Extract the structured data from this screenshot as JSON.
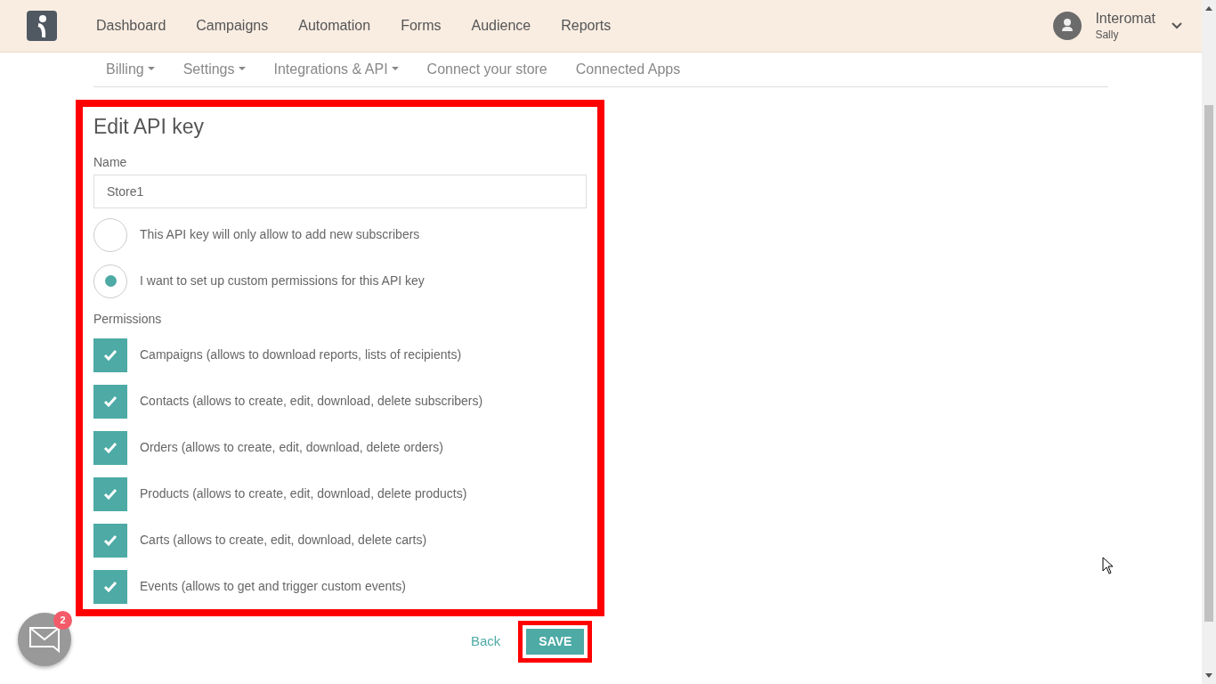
{
  "main_nav": [
    {
      "label": "Dashboard"
    },
    {
      "label": "Campaigns"
    },
    {
      "label": "Automation"
    },
    {
      "label": "Forms"
    },
    {
      "label": "Audience"
    },
    {
      "label": "Reports"
    }
  ],
  "account": {
    "name": "Interomat",
    "user": "Sally"
  },
  "sub_nav": [
    {
      "label": "Billing",
      "dropdown": true
    },
    {
      "label": "Settings",
      "dropdown": true
    },
    {
      "label": "Integrations & API",
      "dropdown": true
    },
    {
      "label": "Connect your store",
      "dropdown": false
    },
    {
      "label": "Connected Apps",
      "dropdown": false
    }
  ],
  "form": {
    "title": "Edit API key",
    "name_label": "Name",
    "name_value": "Store1",
    "options": [
      {
        "label": "This API key will only allow to add new subscribers",
        "selected": false
      },
      {
        "label": "I want to set up custom permissions for this API key",
        "selected": true
      }
    ],
    "permissions_label": "Permissions",
    "permissions": [
      {
        "label": "Campaigns (allows to download reports, lists of recipients)",
        "checked": true
      },
      {
        "label": "Contacts (allows to create, edit, download, delete subscribers)",
        "checked": true
      },
      {
        "label": "Orders (allows to create, edit, download, delete orders)",
        "checked": true
      },
      {
        "label": "Products (allows to create, edit, download, delete products)",
        "checked": true
      },
      {
        "label": "Carts (allows to create, edit, download, delete carts)",
        "checked": true
      },
      {
        "label": "Events (allows to get and trigger custom events)",
        "checked": true
      }
    ]
  },
  "actions": {
    "back": "Back",
    "save": "SAVE"
  },
  "chat": {
    "badge": "2"
  }
}
